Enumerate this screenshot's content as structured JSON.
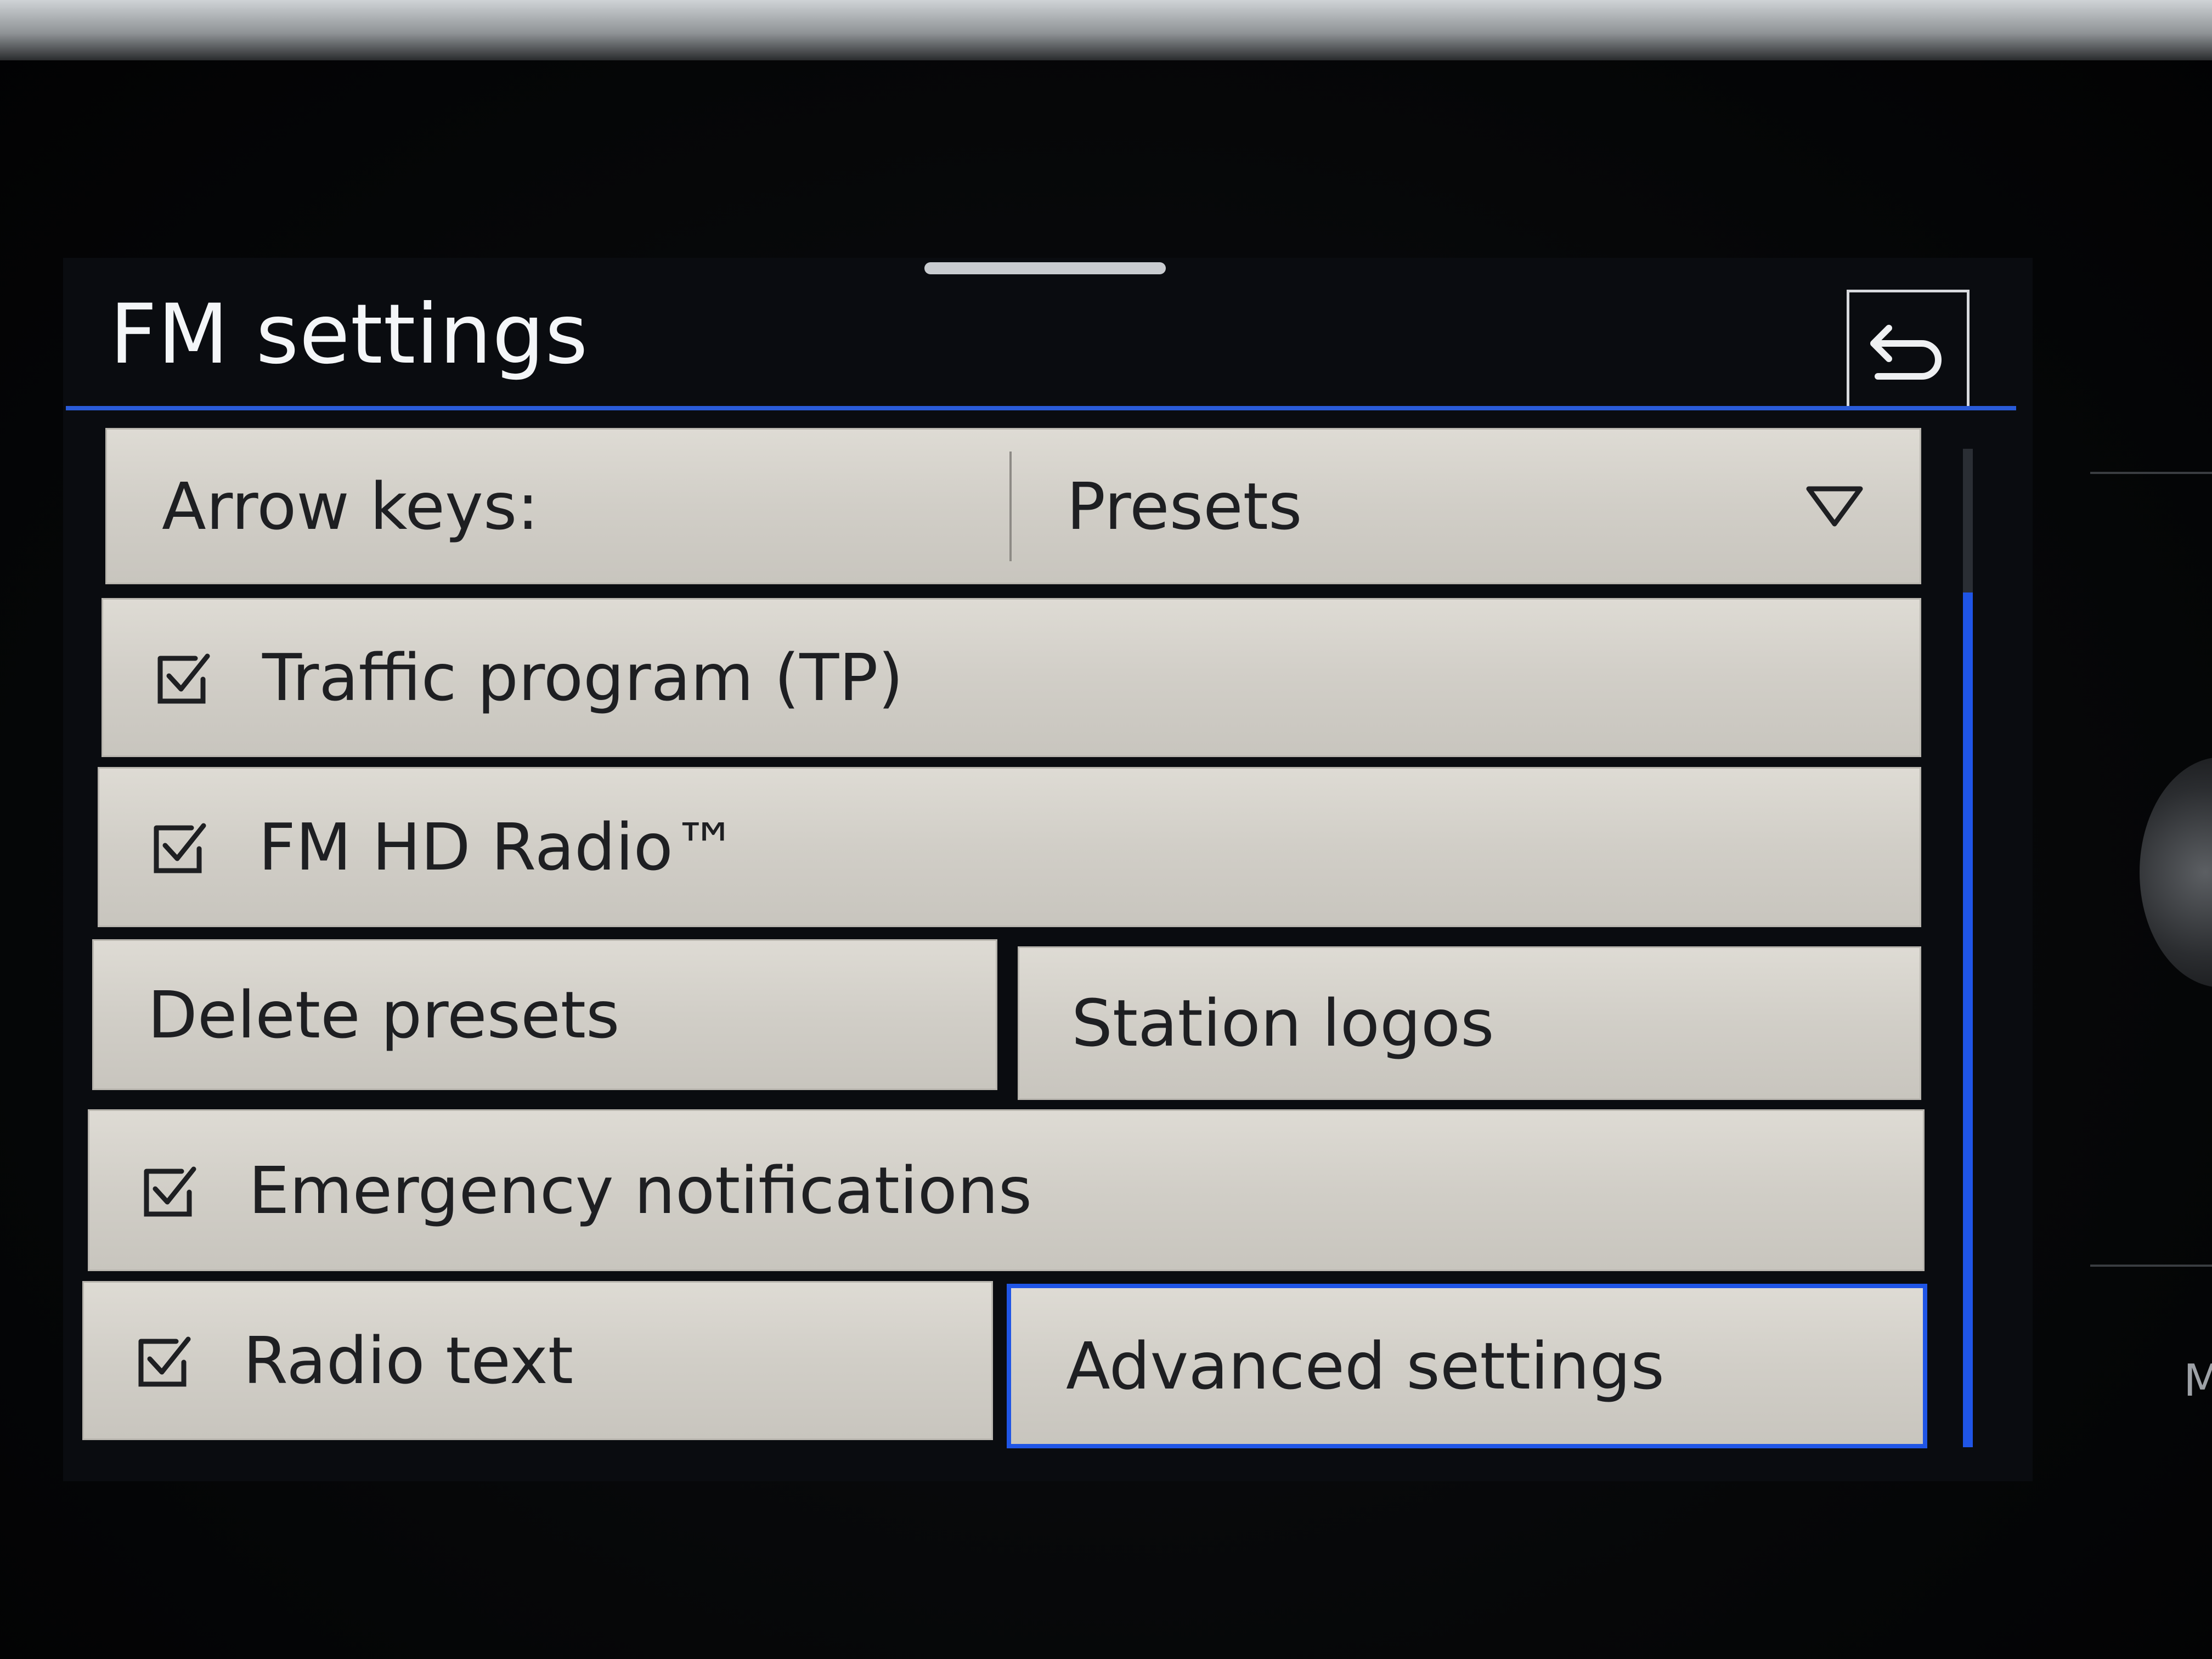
{
  "screen": {
    "title": "FM settings"
  },
  "rows": {
    "arrow_keys": {
      "label": "Arrow keys:",
      "value": "Presets"
    },
    "traffic_program": {
      "label": "Traffic program (TP)",
      "checked": true
    },
    "hd_radio": {
      "label": "FM HD Radio™",
      "checked": true
    },
    "delete_presets": {
      "label": "Delete presets"
    },
    "station_logos": {
      "label": "Station logos"
    },
    "emergency_notifications": {
      "label": "Emergency notifications",
      "checked": true
    },
    "radio_text": {
      "label": "Radio text",
      "checked": true
    },
    "advanced_settings": {
      "label": "Advanced settings"
    }
  },
  "side": {
    "glyph": "M"
  },
  "colors": {
    "accent": "#1f55e6",
    "button_bg": "#d6d3cc",
    "background": "#0a0c10",
    "text_light": "#f4f6f8",
    "text_dark": "#1e1f22"
  },
  "icons": {
    "back": "back-arrow-icon",
    "dropdown": "dropdown-triangle-icon",
    "checkbox": "checkbox-checked-icon"
  }
}
